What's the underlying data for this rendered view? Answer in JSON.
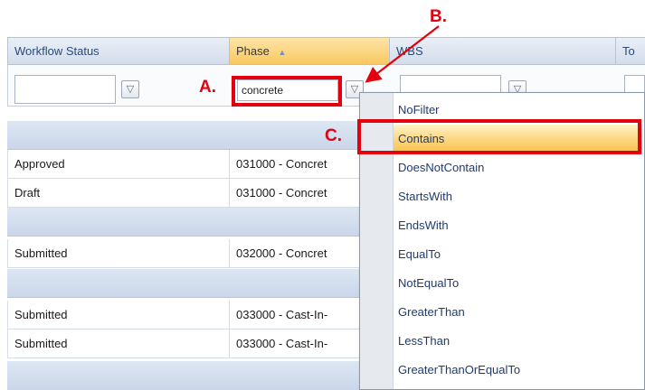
{
  "grid": {
    "columns": [
      {
        "label": "Workflow Status"
      },
      {
        "label": "Phase",
        "sort_indicator": "▲"
      },
      {
        "label": "WBS"
      },
      {
        "label": "To"
      }
    ],
    "filters": {
      "workflow_status": {
        "value": ""
      },
      "phase": {
        "value": "concrete"
      },
      "wbs": {
        "value": ""
      }
    },
    "rows": [
      {
        "status": "Approved",
        "phase": "031000 - Concret"
      },
      {
        "status": "Draft",
        "phase": "031000 - Concret"
      },
      {
        "status": "Submitted",
        "phase": "032000 - Concret"
      },
      {
        "status": "Submitted",
        "phase": "033000 - Cast-In-"
      },
      {
        "status": "Submitted",
        "phase": "033000 - Cast-In-"
      }
    ]
  },
  "filter_menu": {
    "items": [
      "NoFilter",
      "Contains",
      "DoesNotContain",
      "StartsWith",
      "EndsWith",
      "EqualTo",
      "NotEqualTo",
      "GreaterThan",
      "LessThan",
      "GreaterThanOrEqualTo"
    ],
    "selected": "Contains"
  },
  "annotations": {
    "a": "A.",
    "b": "B.",
    "c": "C."
  },
  "icons": {
    "filter": "filter-funnel-icon",
    "sort": "sort-ascending-icon"
  },
  "colors": {
    "annotation_red": "#e3000f",
    "header_active": "#f9c860",
    "menu_highlight": "#fcd57c"
  }
}
